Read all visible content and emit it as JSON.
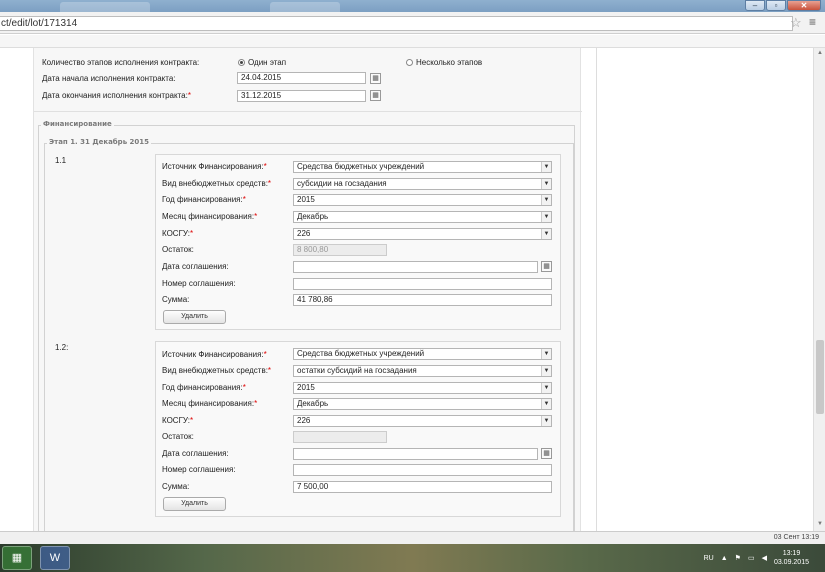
{
  "browser": {
    "url": "ct/edit/lot/171314"
  },
  "contract": {
    "stages_count_label": "Количество этапов исполнения контракта:",
    "stage_option_one": "Один этап",
    "stage_option_many": "Несколько этапов",
    "start_date_label": "Дата начала исполнения контракта:",
    "start_date_value": "24.04.2015",
    "end_date_label": "Дата окончания исполнения контракта:",
    "end_date_value": "31.12.2015"
  },
  "financing": {
    "legend": "Финансирование",
    "stage_legend": "Этап 1. 31 Декабрь 2015",
    "labels": {
      "source": "Источник Финансирования:",
      "extrabudget_type": "Вид внебюджетных средств:",
      "year": "Год финансирования:",
      "month": "Месяц финансирования:",
      "kosgu": "КОСГУ:",
      "balance": "Остаток:",
      "agreement_date": "Дата соглашения:",
      "agreement_number": "Номер соглашения:",
      "amount": "Сумма:",
      "delete_button": "Удалить"
    },
    "items": [
      {
        "number": "1.1",
        "source": "Средства бюджетных учреждений",
        "extrabudget_type": "субсидии на госзадания",
        "year": "2015",
        "month": "Декабрь",
        "kosgu": "226",
        "balance": "8 800,80",
        "agreement_date": "",
        "agreement_number": "",
        "amount": "41 780,86"
      },
      {
        "number": "1.2:",
        "source": "Средства бюджетных учреждений",
        "extrabudget_type": "остатки субсидий на госзадания",
        "year": "2015",
        "month": "Декабрь",
        "kosgu": "226",
        "balance": "",
        "agreement_date": "",
        "agreement_number": "",
        "amount": "7 500,00"
      }
    ]
  },
  "status_bar": {
    "time": "03 Сент 13:19"
  },
  "taskbar": {
    "lang": "RU",
    "clock_time": "13:19",
    "clock_date": "03.09.2015"
  }
}
